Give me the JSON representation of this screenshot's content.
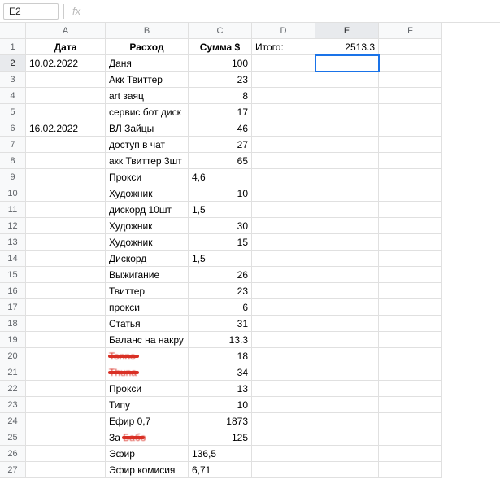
{
  "nameBox": "E2",
  "fxLabel": "fx",
  "columns": [
    "A",
    "B",
    "C",
    "D",
    "E",
    "F"
  ],
  "activeCol": "E",
  "activeRow": 2,
  "headers": {
    "A": "Дата",
    "B": "Расход",
    "C": "Сумма $",
    "D": "Итого:",
    "E": "2513.3"
  },
  "rows": [
    {
      "r": 2,
      "A": "10.02.2022",
      "B": "Даня",
      "C": "100",
      "cn": true,
      "sel": true
    },
    {
      "r": 3,
      "B": "Акк Твиттер",
      "C": "23",
      "cn": true
    },
    {
      "r": 4,
      "B": "art заяц",
      "C": "8",
      "cn": true
    },
    {
      "r": 5,
      "B": "сервис бот диск",
      "C": "17",
      "cn": true
    },
    {
      "r": 6,
      "A": "16.02.2022",
      "B": "ВЛ Зайцы",
      "C": "46",
      "cn": true
    },
    {
      "r": 7,
      "B": "доступ в чат",
      "C": "27",
      "cn": true
    },
    {
      "r": 8,
      "B": "акк Твиттер 3шт",
      "C": "65",
      "cn": true
    },
    {
      "r": 9,
      "B": "Прокси",
      "C": "4,6"
    },
    {
      "r": 10,
      "B": "Художник",
      "C": "10",
      "cn": true
    },
    {
      "r": 11,
      "B": "дискорд 10шт",
      "C": "1,5"
    },
    {
      "r": 12,
      "B": "Художник",
      "C": "30",
      "cn": true
    },
    {
      "r": 13,
      "B": "Художник",
      "C": "15",
      "cn": true
    },
    {
      "r": 14,
      "B": "Дискорд",
      "C": "1,5"
    },
    {
      "r": 15,
      "B": "Выжигание",
      "C": "26",
      "cn": true
    },
    {
      "r": 16,
      "B": "Твиттер",
      "C": "23",
      "cn": true
    },
    {
      "r": 17,
      "B": "прокси",
      "C": "6",
      "cn": true
    },
    {
      "r": 18,
      "B": "Статья",
      "C": "31",
      "cn": true
    },
    {
      "r": 19,
      "B": "Баланс на накру",
      "C": "13.3",
      "cn": true
    },
    {
      "r": 20,
      "B": "Tonno",
      "C": "18",
      "cn": true,
      "strike": true
    },
    {
      "r": 21,
      "B": "Thuna",
      "C": "34",
      "cn": true,
      "strike": true
    },
    {
      "r": 22,
      "B": "Прокси",
      "C": "13",
      "cn": true
    },
    {
      "r": 23,
      "B": "Типу",
      "C": "10",
      "cn": true
    },
    {
      "r": 24,
      "B": "Ефир 0,7",
      "C": "1873",
      "cn": true
    },
    {
      "r": 25,
      "B": "За Бабо",
      "C": "125",
      "cn": true,
      "strikePart": true
    },
    {
      "r": 26,
      "B": "Эфир",
      "C": "136,5"
    },
    {
      "r": 27,
      "B": "Эфир комисия",
      "C": "6,71"
    }
  ]
}
